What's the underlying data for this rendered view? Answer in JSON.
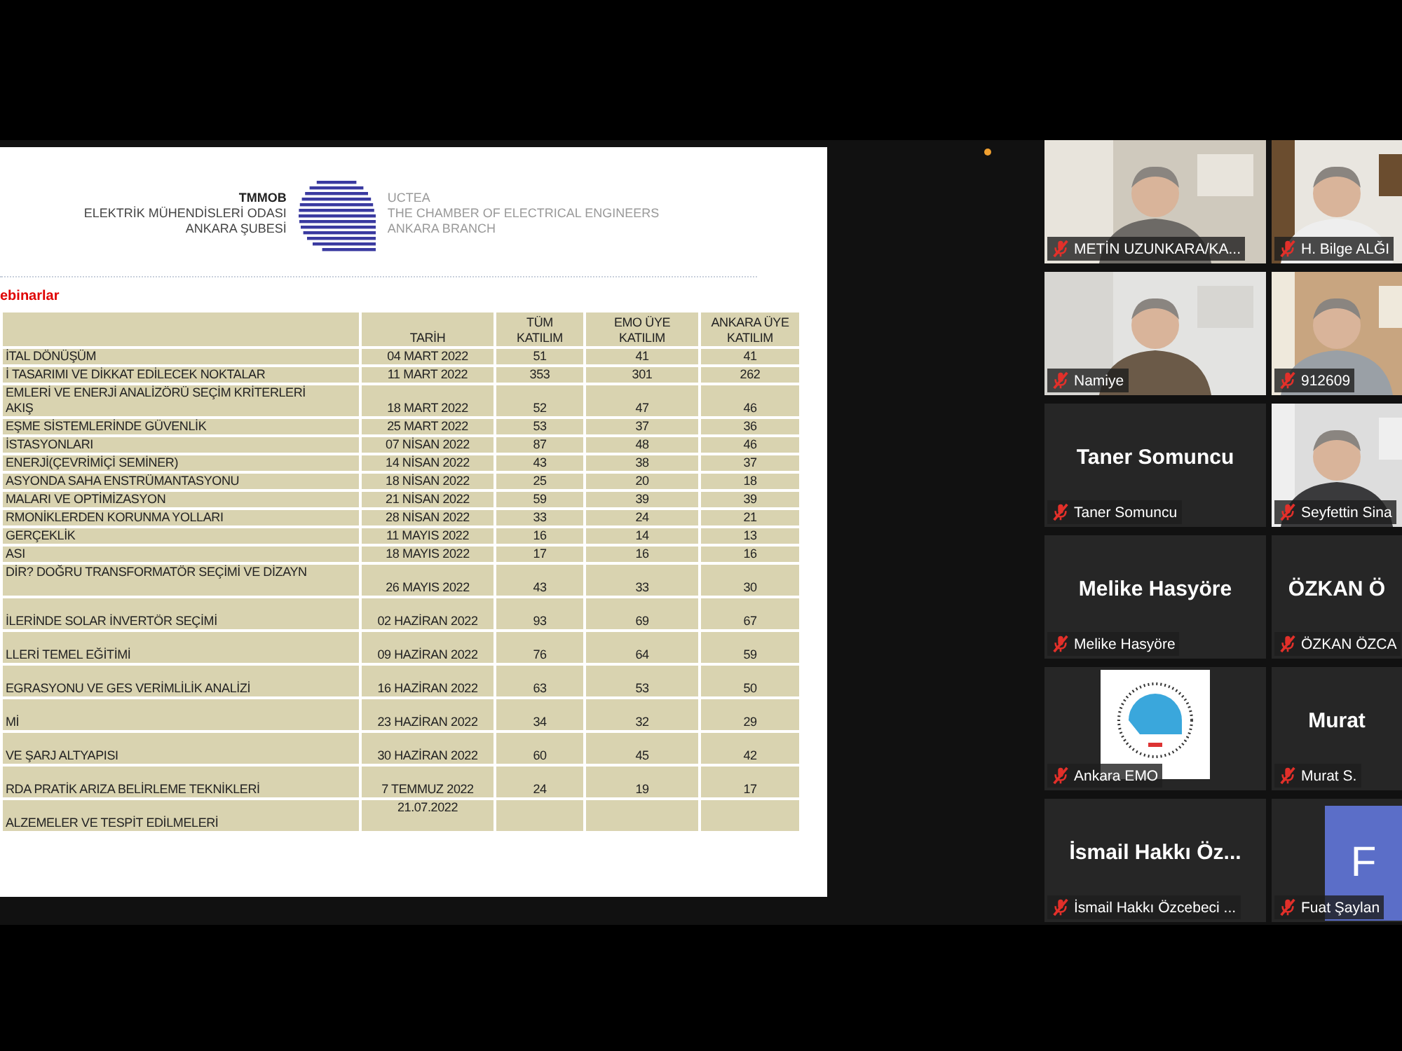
{
  "slide": {
    "logo": {
      "left_lines": [
        "TMMOB",
        "ELEKTRİK MÜHENDİSLERİ ODASI",
        "ANKARA ŞUBESİ"
      ],
      "right_lines": [
        "UCTEA",
        "THE CHAMBER OF ELECTRICAL ENGINEERS",
        "ANKARA BRANCH"
      ]
    },
    "section_title": "ebinarlar",
    "table": {
      "columns": [
        "TARİH",
        "TÜM\nKATILIM",
        "EMO ÜYE\nKATILIM",
        "ANKARA ÜYE\nKATILIM"
      ],
      "rows": [
        {
          "topic": "İTAL DÖNÜŞÜM",
          "date": "04 MART 2022",
          "total": "51",
          "emo": "41",
          "ankara": "41"
        },
        {
          "topic": "İ TASARIMI VE DİKKAT EDİLECEK NOKTALAR",
          "date": "11 MART 2022",
          "total": "353",
          "emo": "301",
          "ankara": "262"
        },
        {
          "topic": "EMLERİ VE ENERJİ ANALİZÖRÜ SEÇİM KRİTERLERİ\nAKIŞ",
          "date": "18 MART 2022",
          "total": "52",
          "emo": "47",
          "ankara": "46"
        },
        {
          "topic": "EŞME SİSTEMLERİNDE GÜVENLİK",
          "date": "25 MART 2022",
          "total": "53",
          "emo": "37",
          "ankara": "36"
        },
        {
          "topic": "İSTASYONLARI",
          "date": "07 NİSAN 2022",
          "total": "87",
          "emo": "48",
          "ankara": "46"
        },
        {
          "topic": "ENERJİ(ÇEVRİMİÇİ SEMİNER)",
          "date": "14 NİSAN 2022",
          "total": "43",
          "emo": "38",
          "ankara": "37"
        },
        {
          "topic": "ASYONDA SAHA ENSTRÜMANTASYONU",
          "date": "18 NİSAN 2022",
          "total": "25",
          "emo": "20",
          "ankara": "18"
        },
        {
          "topic": "MALARI VE OPTİMİZASYON",
          "date": "21 NİSAN 2022",
          "total": "59",
          "emo": "39",
          "ankara": "39"
        },
        {
          "topic": "RMONİKLERDEN KORUNMA YOLLARI",
          "date": "28 NİSAN 2022",
          "total": "33",
          "emo": "24",
          "ankara": "21"
        },
        {
          "topic": "GERÇEKLİK",
          "date": "11 MAYIS 2022",
          "total": "16",
          "emo": "14",
          "ankara": "13"
        },
        {
          "topic": "ASI",
          "date": "18 MAYIS 2022",
          "total": "17",
          "emo": "16",
          "ankara": "16"
        },
        {
          "topic": "DİR? DOĞRU TRANSFORMATÖR SEÇİMİ VE DİZAYN",
          "date": "26 MAYIS 2022",
          "total": "43",
          "emo": "33",
          "ankara": "30"
        },
        {
          "topic": "İLERİNDE SOLAR İNVERTÖR SEÇİMİ",
          "date": "02 HAZİRAN 2022",
          "total": "93",
          "emo": "69",
          "ankara": "67"
        },
        {
          "topic": "LLERİ TEMEL EĞİTİMİ",
          "date": "09 HAZİRAN 2022",
          "total": "76",
          "emo": "64",
          "ankara": "59"
        },
        {
          "topic": "EGRASYONU VE GES VERİMLİLİK ANALİZİ",
          "date": "16 HAZİRAN 2022",
          "total": "63",
          "emo": "53",
          "ankara": "50"
        },
        {
          "topic": "Mİ",
          "date": "23 HAZİRAN 2022",
          "total": "34",
          "emo": "32",
          "ankara": "29"
        },
        {
          "topic": "VE ŞARJ ALTYAPISI",
          "date": "30 HAZİRAN 2022",
          "total": "60",
          "emo": "45",
          "ankara": "42"
        },
        {
          "topic": "RDA PRATİK ARIZA BELİRLEME TEKNİKLERİ",
          "date": "7  TEMMUZ 2022",
          "total": "24",
          "emo": "19",
          "ankara": "17"
        },
        {
          "topic": "ALZEMELER VE TESPİT EDİLMELERİ",
          "date": "21.07.2022"
        }
      ]
    }
  },
  "participants": [
    {
      "kind": "video",
      "name": "METİN UZUNKARA/KA...",
      "muted": true
    },
    {
      "kind": "video",
      "name": "H. Bilge ALĞI",
      "muted": true
    },
    {
      "kind": "video",
      "name": "Namiye",
      "muted": true
    },
    {
      "kind": "video",
      "name": "912609",
      "muted": true
    },
    {
      "kind": "name",
      "display": "Taner Somuncu",
      "name": "Taner Somuncu",
      "muted": true
    },
    {
      "kind": "video",
      "name": "Seyfettin Sina",
      "muted": true
    },
    {
      "kind": "name",
      "display": "Melike Hasyöre",
      "name": "Melike Hasyöre",
      "muted": true
    },
    {
      "kind": "name",
      "display": "ÖZKAN Ö",
      "name": "ÖZKAN ÖZCA",
      "muted": true
    },
    {
      "kind": "logo",
      "name": "Ankara EMO",
      "muted": true
    },
    {
      "kind": "name",
      "display": "Murat",
      "name": "Murat S.",
      "muted": true
    },
    {
      "kind": "name",
      "display": "İsmail Hakkı Öz...",
      "name": "İsmail Hakkı Özcebeci ...",
      "muted": true
    },
    {
      "kind": "avatar",
      "initial": "F",
      "name": "Fuat Şaylan",
      "muted": true
    }
  ]
}
